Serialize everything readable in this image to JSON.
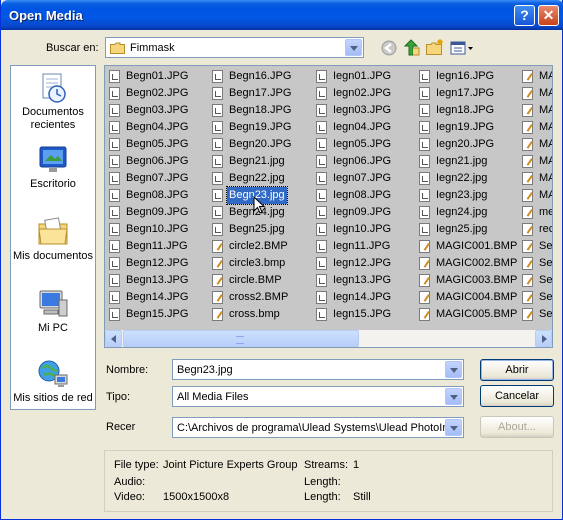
{
  "window": {
    "title": "Open Media",
    "help_glyph": "?",
    "close_glyph": "✕"
  },
  "lookin": {
    "label": "Buscar en:",
    "value": "Fimmask"
  },
  "toolbar": {
    "icons": [
      "back-icon",
      "up-folder-icon",
      "new-folder-icon",
      "view-menu-icon"
    ]
  },
  "places": [
    {
      "label": "Documentos recientes",
      "icon": "recent-documents-icon"
    },
    {
      "label": "Escritorio",
      "icon": "desktop-icon"
    },
    {
      "label": "Mis documentos",
      "icon": "my-documents-icon"
    },
    {
      "label": "Mi PC",
      "icon": "my-computer-icon"
    },
    {
      "label": "Mis sitios de red",
      "icon": "network-places-icon"
    }
  ],
  "files": {
    "selected": "Begn23.jpg",
    "columns": [
      [
        "Begn01.JPG",
        "Begn02.JPG",
        "Begn03.JPG",
        "Begn04.JPG",
        "Begn05.JPG",
        "Begn06.JPG",
        "Begn07.JPG",
        "Begn08.JPG",
        "Begn09.JPG",
        "Begn10.JPG",
        "Begn11.JPG",
        "Begn12.JPG",
        "Begn13.JPG",
        "Begn14.JPG",
        "Begn15.JPG"
      ],
      [
        "Begn16.JPG",
        "Begn17.JPG",
        "Begn18.JPG",
        "Begn19.JPG",
        "Begn20.JPG",
        "Begn21.jpg",
        "Begn22.jpg",
        "Begn23.jpg",
        "Begn24.jpg",
        "Begn25.jpg",
        "circle2.BMP",
        "circle3.bmp",
        "circle.BMP",
        "cross2.BMP",
        "cross.bmp"
      ],
      [
        "Iegn01.JPG",
        "Iegn02.JPG",
        "Iegn03.JPG",
        "Iegn04.JPG",
        "Iegn05.JPG",
        "Iegn06.JPG",
        "Iegn07.JPG",
        "Iegn08.JPG",
        "Iegn09.JPG",
        "Iegn10.JPG",
        "Iegn11.JPG",
        "Iegn12.JPG",
        "Iegn13.JPG",
        "Iegn14.JPG",
        "Iegn15.JPG"
      ],
      [
        "Iegn16.JPG",
        "Iegn17.JPG",
        "Iegn18.JPG",
        "Iegn19.JPG",
        "Iegn20.JPG",
        "Iegn21.jpg",
        "Iegn22.jpg",
        "Iegn23.jpg",
        "Iegn24.jpg",
        "Iegn25.jpg",
        "MAGIC001.BMP",
        "MAGIC002.BMP",
        "MAGIC003.BMP",
        "MAGIC004.BMP",
        "MAGIC005.BMP"
      ],
      [
        "MA",
        "MA",
        "MA",
        "MA",
        "MA",
        "MA",
        "MA",
        "MA",
        "met",
        "recl",
        "Seg",
        "Seg",
        "Seg",
        "Seg",
        "Seg"
      ]
    ]
  },
  "name_field": {
    "label": "Nombre:",
    "value": "Begn23.jpg"
  },
  "type_field": {
    "label": "Tipo:",
    "value": "All Media Files"
  },
  "recer_field": {
    "label": "Recer",
    "value": "C:\\Archivos de programa\\Ulead Systems\\Ulead PhotoIm"
  },
  "buttons": {
    "open": "Abrir",
    "cancel": "Cancelar",
    "about": "About..."
  },
  "info": {
    "file_type_label": "File type:",
    "file_type_value": "Joint Picture Experts Group",
    "audio_label": "Audio:",
    "audio_value": "",
    "video_label": "Video:",
    "video_value": "1500x1500x8",
    "streams_label": "Streams:",
    "streams_value": "1",
    "length_label": "Length:",
    "length_value": "",
    "length2_label": "Length:",
    "length2_value": "Still"
  },
  "colors": {
    "titlebar": "#0054e3",
    "selection": "#316ac5",
    "dialog_bg": "#ece9d8",
    "list_gray": "#c7c7c7"
  }
}
